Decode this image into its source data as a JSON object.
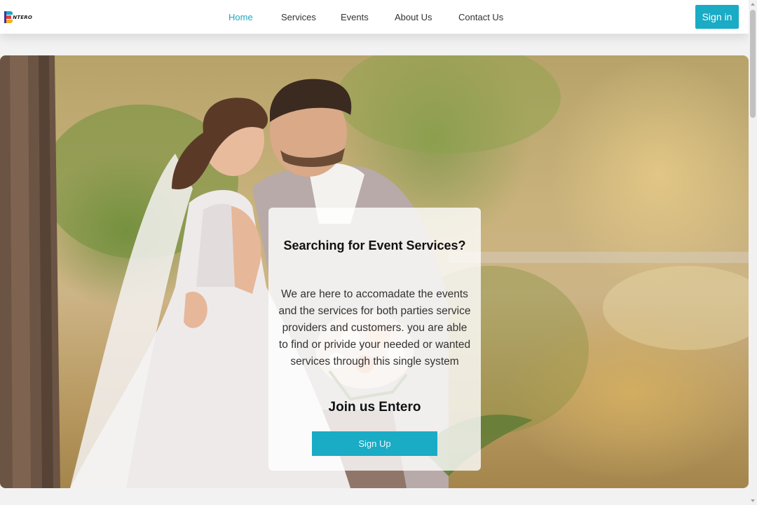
{
  "brand": {
    "logo_text": "NTERO"
  },
  "nav": {
    "links": [
      "Home",
      "Services",
      "Events",
      "About Us",
      "Contact Us"
    ],
    "active": "Home",
    "signin_label": "Sign in"
  },
  "hero": {
    "card": {
      "title": "Searching for Event Services?",
      "description": "We are here to accomadate the events and the services for both parties service providers and customers. you are able to find or privide your needed or wanted services through this single system",
      "join_text": "Join us Entero",
      "signup_label": "Sign Up"
    }
  },
  "colors": {
    "accent": "#1aabc5",
    "navbar_bg": "#ffffff",
    "page_bg": "#f2f2f2"
  }
}
